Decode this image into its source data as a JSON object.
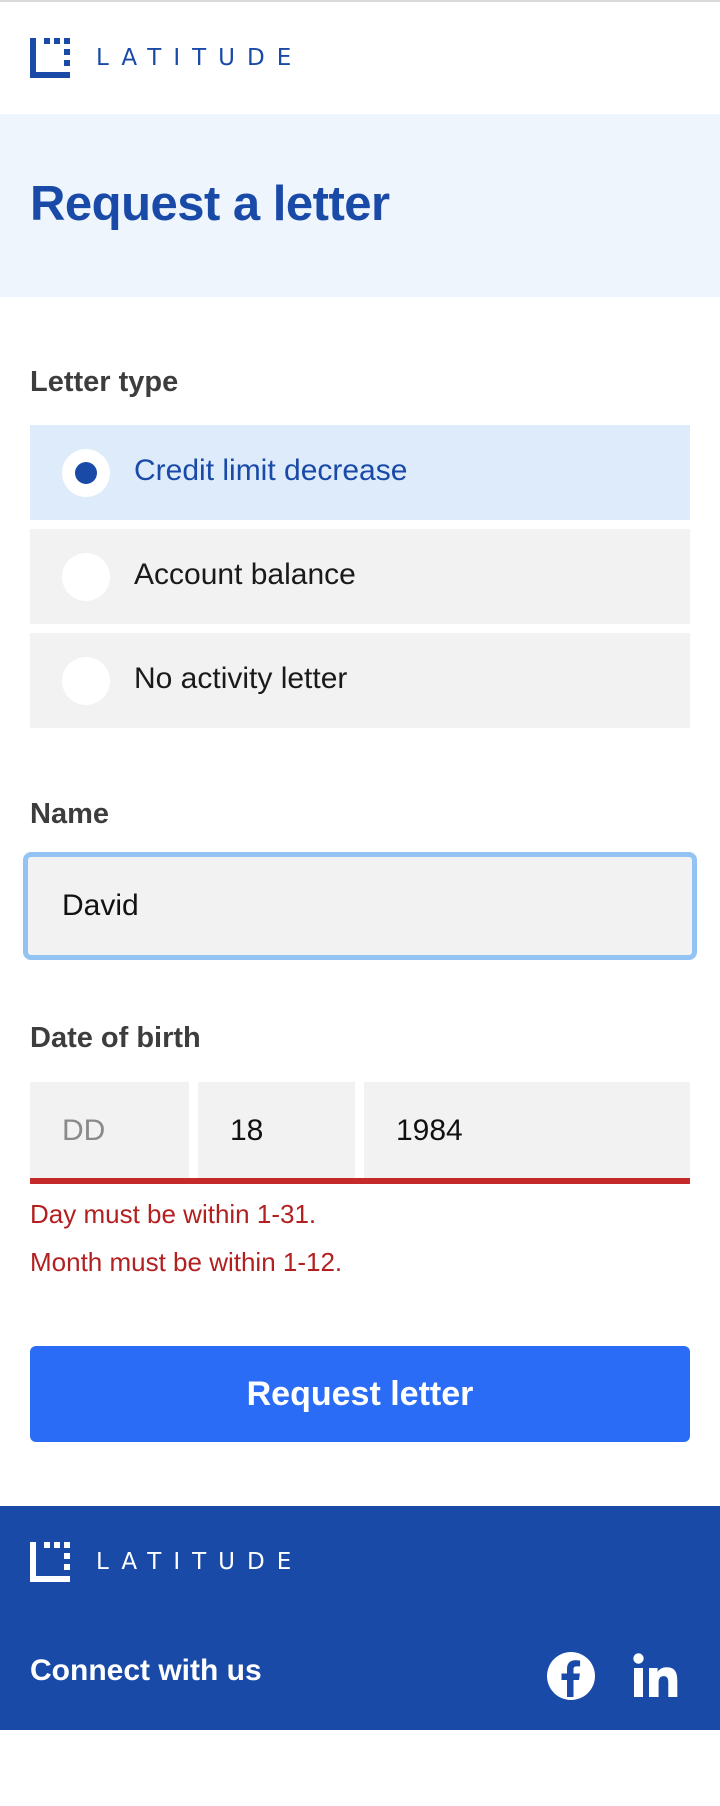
{
  "brand": {
    "name": "LATITUDE",
    "color": "#1a4aa8"
  },
  "page": {
    "title": "Request a letter"
  },
  "letter_type": {
    "label": "Letter type",
    "options": [
      {
        "label": "Credit limit decrease",
        "selected": true
      },
      {
        "label": "Account balance",
        "selected": false
      },
      {
        "label": "No activity letter",
        "selected": false
      }
    ]
  },
  "name_field": {
    "label": "Name",
    "value": "David"
  },
  "dob": {
    "label": "Date of birth",
    "day": {
      "value": "",
      "placeholder": "DD"
    },
    "month": {
      "value": "18"
    },
    "year": {
      "value": "1984"
    },
    "errors": [
      "Day must be within 1-31.",
      "Month must be within 1-12."
    ],
    "error_color": "#c42a2a"
  },
  "submit": {
    "label": "Request letter",
    "color": "#2b6cf6"
  },
  "footer": {
    "brand": "LATITUDE",
    "connect_label": "Connect with us",
    "social": [
      "facebook-icon",
      "linkedin-icon"
    ]
  }
}
